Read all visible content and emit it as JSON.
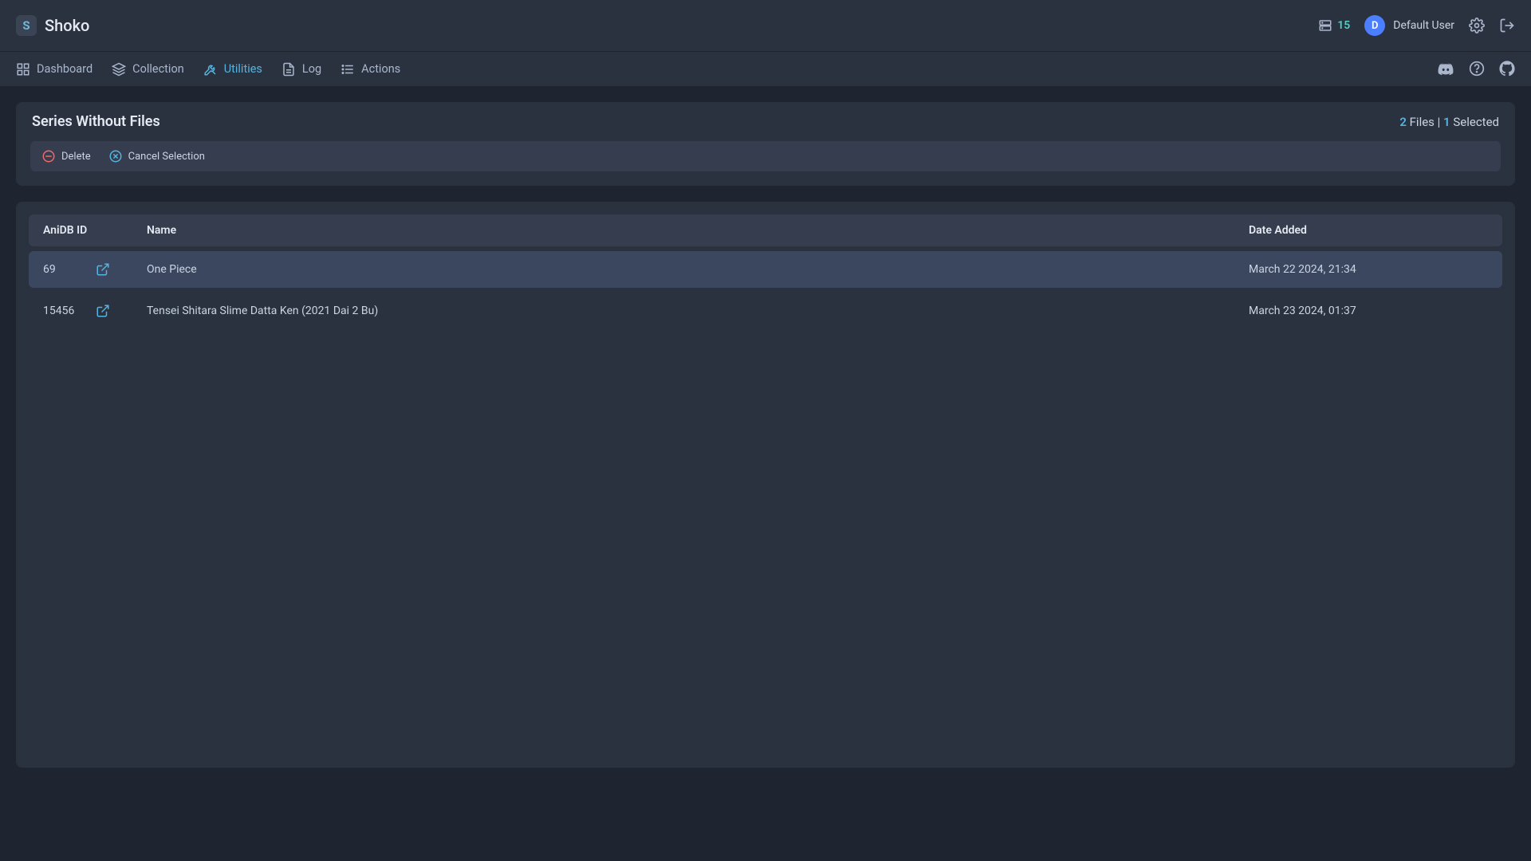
{
  "brand": {
    "mark": "S",
    "name": "Shoko"
  },
  "header": {
    "queue_count": "15",
    "avatar_initial": "D",
    "user_name": "Default User"
  },
  "nav": {
    "items": [
      {
        "label": "Dashboard"
      },
      {
        "label": "Collection"
      },
      {
        "label": "Utilities"
      },
      {
        "label": "Log"
      },
      {
        "label": "Actions"
      }
    ]
  },
  "panel": {
    "title": "Series Without Files",
    "status": {
      "files_count": "2",
      "files_label": "Files",
      "sep": " | ",
      "selected_count": "1",
      "selected_label": "Selected"
    },
    "toolbar": {
      "delete": "Delete",
      "cancel": "Cancel Selection"
    }
  },
  "table": {
    "columns": {
      "anidb": "AniDB ID",
      "name": "Name",
      "date": "Date Added"
    },
    "rows": [
      {
        "id": "69",
        "name": "One Piece",
        "date": "March 22 2024, 21:34",
        "selected": true
      },
      {
        "id": "15456",
        "name": "Tensei Shitara Slime Datta Ken (2021 Dai 2 Bu)",
        "date": "March 23 2024, 01:37",
        "selected": false
      }
    ]
  }
}
